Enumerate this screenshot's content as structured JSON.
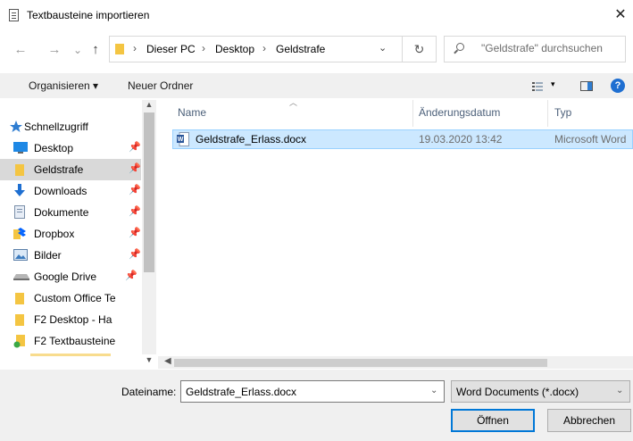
{
  "window": {
    "title": "Textbausteine importieren",
    "close": "✕"
  },
  "nav": {
    "back": "←",
    "forward": "→",
    "recent": "⌄",
    "up": "↑"
  },
  "address": {
    "crumbs": [
      "Dieser PC",
      "Desktop",
      "Geldstrafe"
    ],
    "separator": "›",
    "dropdown": "⌄",
    "refresh": "↻"
  },
  "search": {
    "placeholder": "\"Geldstrafe\" durchsuchen"
  },
  "toolbar": {
    "organize": "Organisieren ▾",
    "new_folder": "Neuer Ordner",
    "view_dropdown": "▾",
    "help": "?"
  },
  "sidebar": {
    "items": [
      {
        "label": "Schnellzugriff",
        "icon": "star-icon",
        "pinned": false
      },
      {
        "label": "Desktop",
        "icon": "desktop-icon",
        "pinned": true
      },
      {
        "label": "Geldstrafe",
        "icon": "folder-icon",
        "pinned": true,
        "selected": true
      },
      {
        "label": "Downloads",
        "icon": "download-icon",
        "pinned": true
      },
      {
        "label": "Dokumente",
        "icon": "documents-icon",
        "pinned": true
      },
      {
        "label": "Dropbox",
        "icon": "dropbox-icon",
        "pinned": true
      },
      {
        "label": "Bilder",
        "icon": "pictures-icon",
        "pinned": true
      },
      {
        "label": "Google Drive",
        "icon": "drive-icon",
        "pinned": true
      },
      {
        "label": "Custom Office Te",
        "icon": "folder-icon",
        "pinned": false
      },
      {
        "label": "F2 Desktop - Ha",
        "icon": "folder-icon",
        "pinned": false
      },
      {
        "label": "F2 Textbausteine",
        "icon": "folder-shortcut-icon",
        "pinned": false
      }
    ]
  },
  "filelist": {
    "columns": [
      "Name",
      "Änderungsdatum",
      "Typ"
    ],
    "rows": [
      {
        "name": "Geldstrafe_Erlass.docx",
        "date": "19.03.2020 13:42",
        "type": "Microsoft Word"
      }
    ]
  },
  "footer": {
    "filename_label": "Dateiname:",
    "filename_value": "Geldstrafe_Erlass.docx",
    "filetype_value": "Word Documents (*.docx)",
    "open": "Öffnen",
    "cancel": "Abbrechen"
  },
  "colors": {
    "accent": "#0078d7",
    "selection": "#cce8ff",
    "folder": "#f4c542",
    "word": "#2b579a"
  }
}
